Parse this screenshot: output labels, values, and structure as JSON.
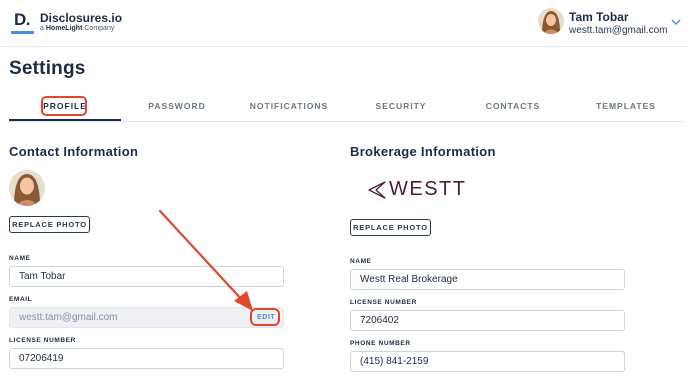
{
  "header": {
    "logo_mark": "D.",
    "logo_name": "Disclosures.io",
    "logo_sub_prefix": "a",
    "logo_sub_brand": "HomeLight",
    "logo_sub_suffix": "Company",
    "user_name": "Tam Tobar",
    "user_email": "westt.tam@gmail.com"
  },
  "page": {
    "title": "Settings"
  },
  "tabs": [
    {
      "label": "PROFILE",
      "active": true
    },
    {
      "label": "PASSWORD",
      "active": false
    },
    {
      "label": "NOTIFICATIONS",
      "active": false
    },
    {
      "label": "SECURITY",
      "active": false
    },
    {
      "label": "CONTACTS",
      "active": false
    },
    {
      "label": "TEMPLATES",
      "active": false
    }
  ],
  "contact": {
    "title": "Contact Information",
    "replace_photo": "REPLACE PHOTO",
    "name_label": "NAME",
    "name_value": "Tam Tobar",
    "email_label": "EMAIL",
    "email_value": "westt.tam@gmail.com",
    "edit_label": "EDIT",
    "license_label": "LICENSE NUMBER",
    "license_value": "07206419"
  },
  "brokerage": {
    "title": "Brokerage Information",
    "logo_text": "WESTT",
    "replace_photo": "REPLACE PHOTO",
    "name_label": "NAME",
    "name_value": "Westt Real Brokerage",
    "license_label": "LICENSE NUMBER",
    "license_value": "7206402",
    "phone_label": "PHONE NUMBER",
    "phone_value": "(415) 841-2159"
  },
  "colors": {
    "annotation": "#e2462c",
    "accent": "#4a90e2",
    "navy": "#1d2b44",
    "brand_logo": "#4b1f3a"
  },
  "icons": [
    "chevron-down-icon",
    "westt-logo-icon",
    "annotation-arrow"
  ]
}
